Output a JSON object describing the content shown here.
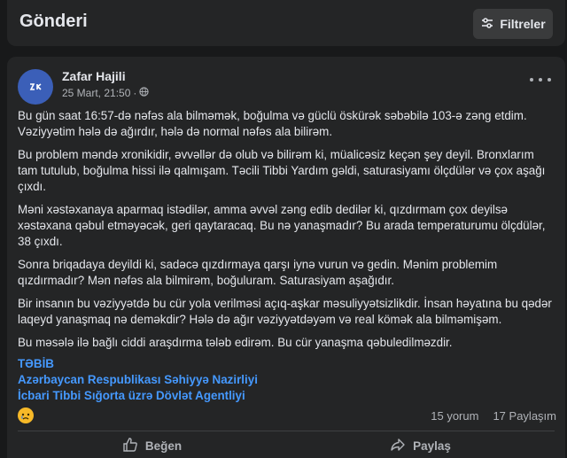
{
  "header": {
    "title": "Gönderi",
    "filters_label": "Filtreler"
  },
  "post": {
    "author": "Zafar Hajili",
    "timestamp": "25 Mart, 21:50",
    "separator": "·",
    "avatar_icon": "avatar-logo",
    "paragraphs": [
      "Bu gün saat 16:57-də nəfəs ala bilməmək, boğulma və güclü öskürək səbəbilə 103-ə zəng etdim. Vəziyyətim hələ də ağırdır, hələ də normal nəfəs ala bilirəm.",
      "Bu problem məndə xronikidir, əvvəllər də olub və bilirəm ki, müalicəsiz keçən şey deyil. Bronxlarım tam tutulub, boğulma hissi ilə qalmışam. Təcili Tibbi Yardım gəldi, saturasiyamı ölçdülər və çox aşağı çıxdı.",
      "Məni xəstəxanaya aparmaq istədilər, amma əvvəl zəng edib dedilər ki, qızdırmam çox deyilsə xəstəxana qəbul etməyəcək, geri qaytaracaq. Bu nə yanaşmadır? Bu arada temperaturumu ölçdülər, 38 çıxdı.",
      "Sonra briqadaya deyildi ki, sadəcə qızdırmaya qarşı iynə vurun və gedin. Mənim problemim qızdırmadır? Mən nəfəs ala bilmirəm, boğuluram. Saturasiyam aşağıdır.",
      "Bir insanın bu vəziyyətdə bu cür yola verilməsi açıq-aşkar məsuliyyətsizlikdir. İnsan həyatına bu qədər laqeyd yanaşmaq nə deməkdir? Hələ də ağır vəziyyətdəyəm və real kömək ala bilməmişəm.",
      "Bu məsələ ilə bağlı ciddi araşdırma tələb edirəm. Bu cür yanaşma qəbuledilməzdir."
    ],
    "tags": [
      "TƏBİB",
      "Azərbaycan Respublikası Səhiyyə Nazirliyi",
      "İcbari Tibbi Sığorta üzrə Dövlət Agentliyi"
    ],
    "reaction_icon": "sad-face-icon",
    "comments_label": "15 yorum",
    "shares_label": "17 Paylaşım",
    "like_label": "Beğen",
    "share_label": "Paylaş"
  }
}
